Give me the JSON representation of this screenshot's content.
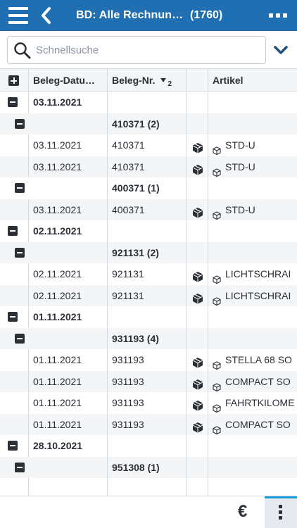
{
  "header": {
    "title": "BD: Alle Rechnun…",
    "count": "(1760)"
  },
  "search": {
    "placeholder": "Schnellsuche"
  },
  "columns": {
    "date": "Beleg-Datu…",
    "number": "Beleg-Nr.",
    "sort_index": "2",
    "article": "Artikel"
  },
  "groups": [
    {
      "date": "03.11.2021",
      "subgroups": [
        {
          "number": "410371 (2)",
          "rows": [
            {
              "date": "03.11.2021",
              "number": "410371",
              "article": "STD-U"
            },
            {
              "date": "03.11.2021",
              "number": "410371",
              "article": "STD-U"
            }
          ]
        },
        {
          "number": "400371 (1)",
          "rows": [
            {
              "date": "03.11.2021",
              "number": "400371",
              "article": "STD-U"
            }
          ]
        }
      ]
    },
    {
      "date": "02.11.2021",
      "subgroups": [
        {
          "number": "921131 (2)",
          "rows": [
            {
              "date": "02.11.2021",
              "number": "921131",
              "article": "LICHTSCHRAI"
            },
            {
              "date": "02.11.2021",
              "number": "921131",
              "article": "LICHTSCHRAI"
            }
          ]
        }
      ]
    },
    {
      "date": "01.11.2021",
      "subgroups": [
        {
          "number": "931193 (4)",
          "rows": [
            {
              "date": "01.11.2021",
              "number": "931193",
              "article": "STELLA 68 SO"
            },
            {
              "date": "01.11.2021",
              "number": "931193",
              "article": "COMPACT SO"
            },
            {
              "date": "01.11.2021",
              "number": "931193",
              "article": "FAHRTKILOME"
            },
            {
              "date": "01.11.2021",
              "number": "931193",
              "article": "COMPACT SO"
            }
          ]
        }
      ]
    },
    {
      "date": "28.10.2021",
      "subgroups": [
        {
          "number": "951308 (1)",
          "rows": []
        }
      ]
    }
  ],
  "footer": {
    "currency_symbol": "€"
  },
  "colors": {
    "header_bg": "#1f6fb2",
    "accent": "#1f9bd7",
    "row_alt": "#f4f5f7"
  }
}
